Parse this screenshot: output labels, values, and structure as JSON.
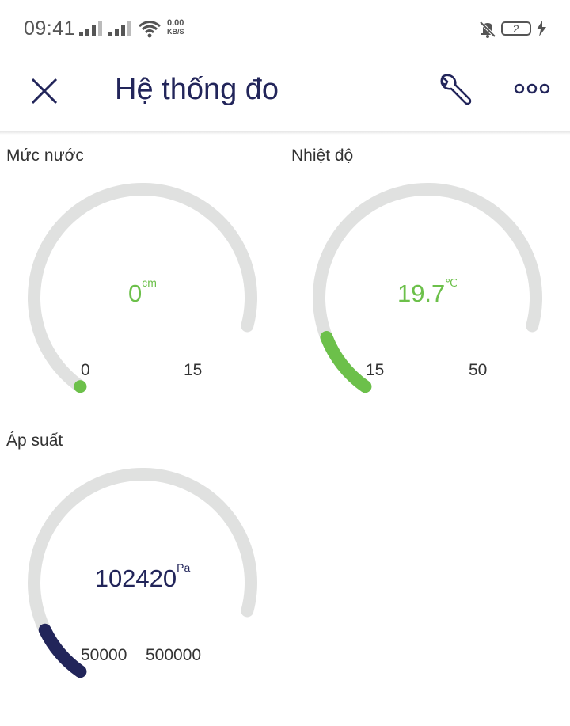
{
  "status_bar": {
    "time": "09:41",
    "net_speed_value": "0.00",
    "net_speed_unit": "KB/S",
    "battery_level": "2"
  },
  "app_bar": {
    "title": "Hệ thống đo",
    "close_icon": "close-icon",
    "settings_icon": "wrench-icon",
    "more_icon": "more-icon"
  },
  "colors": {
    "title": "#22255a",
    "track": "#e0e1e0",
    "green": "#6cc04a",
    "navy": "#22255a"
  },
  "gauges": [
    {
      "label": "Mức nước",
      "value": "0",
      "unit": "cm",
      "min": "0",
      "max": "15",
      "numeric_value": 0,
      "numeric_min": 0,
      "numeric_max": 15,
      "color": "#6cc04a"
    },
    {
      "label": "Nhiệt độ",
      "value": "19.7",
      "unit": "℃",
      "min": "15",
      "max": "50",
      "numeric_value": 19.7,
      "numeric_min": 15,
      "numeric_max": 50,
      "color": "#6cc04a"
    },
    {
      "label": "Áp suất",
      "value": "102420",
      "unit": "Pa",
      "min": "50000",
      "max": "500000",
      "numeric_value": 102420,
      "numeric_min": 50000,
      "numeric_max": 500000,
      "color": "#22255a"
    }
  ]
}
